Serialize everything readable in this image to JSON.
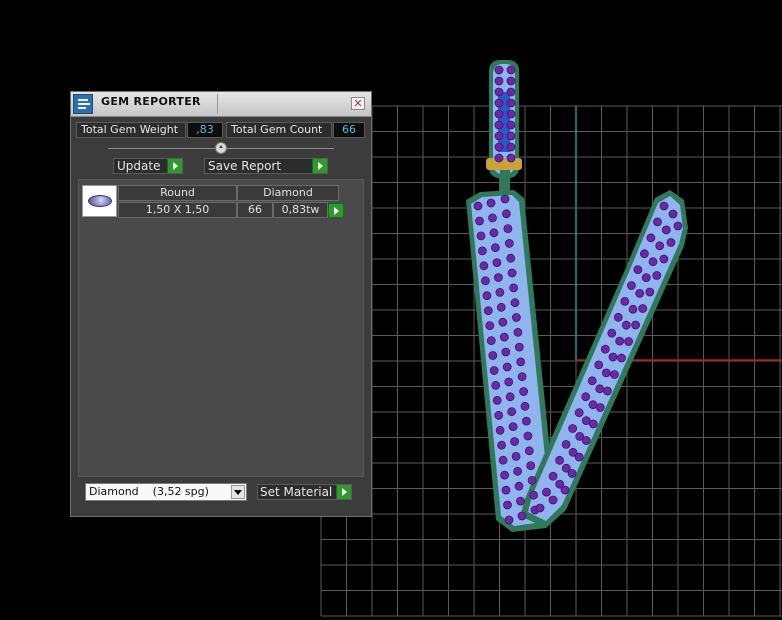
{
  "window": {
    "title": "GEM REPORTER",
    "close_glyph": "✕"
  },
  "summary": {
    "weight_label": "Total Gem Weight",
    "weight_value": ",83",
    "count_label": "Total Gem Count",
    "count_value": "66"
  },
  "actions": {
    "update_label": "Update",
    "save_label": "Save Report"
  },
  "table": {
    "headers": [
      "Round",
      "Diamond"
    ],
    "rows": [
      {
        "size": "1,50 X 1,50",
        "count": "66",
        "weight": "0,83tw"
      }
    ]
  },
  "material": {
    "selected": "Diamond    (3,52 spg)",
    "set_label": "Set Material"
  },
  "colors": {
    "value_text": "#5fb6e8",
    "accent_green": "#2e9a2e",
    "viewport_grid": "#5a5a5a",
    "axis_cyan": "#1e90a8",
    "axis_red": "#b02020",
    "gem_fill": "#8fb4ee",
    "gem_outline": "#2f7a5c",
    "stone_purple": "#6a2aa8"
  }
}
